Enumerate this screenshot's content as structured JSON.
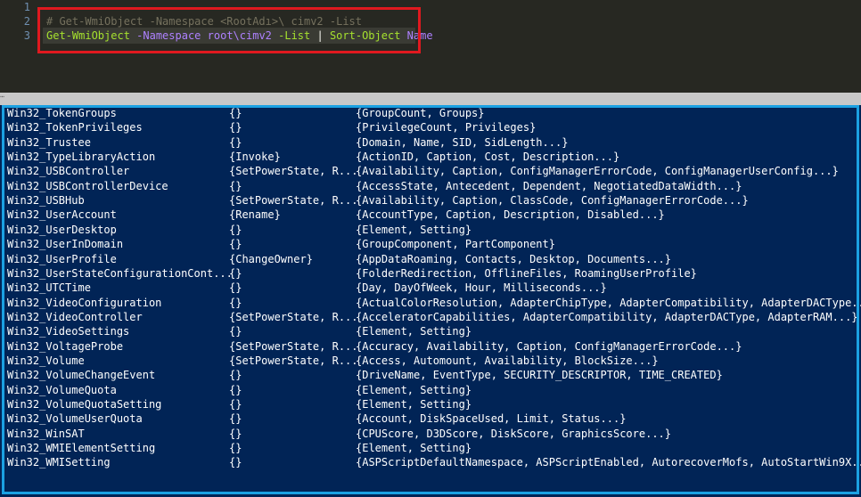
{
  "editor": {
    "line_numbers": [
      "1",
      "2",
      "3"
    ],
    "line2": "# Get-WmiObject -Namespace <RootAdı>\\ cimv2 -List",
    "line3": {
      "cmd1": "Get-WmiObject",
      "param1": "-Namespace",
      "arg1": "root\\cimv2",
      "param2": "-List",
      "pipe": "|",
      "cmd2": "Sort-Object",
      "arg2": "Name"
    }
  },
  "console": {
    "rows": [
      {
        "name": "Win32_TokenGroups",
        "methods": "{}",
        "properties": "{GroupCount, Groups}"
      },
      {
        "name": "Win32_TokenPrivileges",
        "methods": "{}",
        "properties": "{PrivilegeCount, Privileges}"
      },
      {
        "name": "Win32_Trustee",
        "methods": "{}",
        "properties": "{Domain, Name, SID, SidLength...}"
      },
      {
        "name": "Win32_TypeLibraryAction",
        "methods": "{Invoke}",
        "properties": "{ActionID, Caption, Cost, Description...}"
      },
      {
        "name": "Win32_USBController",
        "methods": "{SetPowerState, R...",
        "properties": "{Availability, Caption, ConfigManagerErrorCode, ConfigManagerUserConfig...}"
      },
      {
        "name": "Win32_USBControllerDevice",
        "methods": "{}",
        "properties": "{AccessState, Antecedent, Dependent, NegotiatedDataWidth...}"
      },
      {
        "name": "Win32_USBHub",
        "methods": "{SetPowerState, R...",
        "properties": "{Availability, Caption, ClassCode, ConfigManagerErrorCode...}"
      },
      {
        "name": "Win32_UserAccount",
        "methods": "{Rename}",
        "properties": "{AccountType, Caption, Description, Disabled...}"
      },
      {
        "name": "Win32_UserDesktop",
        "methods": "{}",
        "properties": "{Element, Setting}"
      },
      {
        "name": "Win32_UserInDomain",
        "methods": "{}",
        "properties": "{GroupComponent, PartComponent}"
      },
      {
        "name": "Win32_UserProfile",
        "methods": "{ChangeOwner}",
        "properties": "{AppDataRoaming, Contacts, Desktop, Documents...}"
      },
      {
        "name": "Win32_UserStateConfigurationCont...",
        "methods": "{}",
        "properties": "{FolderRedirection, OfflineFiles, RoamingUserProfile}"
      },
      {
        "name": "Win32_UTCTime",
        "methods": "{}",
        "properties": "{Day, DayOfWeek, Hour, Milliseconds...}"
      },
      {
        "name": "Win32_VideoConfiguration",
        "methods": "{}",
        "properties": "{ActualColorResolution, AdapterChipType, AdapterCompatibility, AdapterDACType..."
      },
      {
        "name": "Win32_VideoController",
        "methods": "{SetPowerState, R...",
        "properties": "{AcceleratorCapabilities, AdapterCompatibility, AdapterDACType, AdapterRAM...}"
      },
      {
        "name": "Win32_VideoSettings",
        "methods": "{}",
        "properties": "{Element, Setting}"
      },
      {
        "name": "Win32_VoltageProbe",
        "methods": "{SetPowerState, R...",
        "properties": "{Accuracy, Availability, Caption, ConfigManagerErrorCode...}"
      },
      {
        "name": "Win32_Volume",
        "methods": "{SetPowerState, R...",
        "properties": "{Access, Automount, Availability, BlockSize...}"
      },
      {
        "name": "Win32_VolumeChangeEvent",
        "methods": "{}",
        "properties": "{DriveName, EventType, SECURITY_DESCRIPTOR, TIME_CREATED}"
      },
      {
        "name": "Win32_VolumeQuota",
        "methods": "{}",
        "properties": "{Element, Setting}"
      },
      {
        "name": "Win32_VolumeQuotaSetting",
        "methods": "{}",
        "properties": "{Element, Setting}"
      },
      {
        "name": "Win32_VolumeUserQuota",
        "methods": "{}",
        "properties": "{Account, DiskSpaceUsed, Limit, Status...}"
      },
      {
        "name": "Win32_WinSAT",
        "methods": "{}",
        "properties": "{CPUScore, D3DScore, DiskScore, GraphicsScore...}"
      },
      {
        "name": "Win32_WMIElementSetting",
        "methods": "{}",
        "properties": "{Element, Setting}"
      },
      {
        "name": "Win32_WMISetting",
        "methods": "{}",
        "properties": "{ASPScriptDefaultNamespace, ASPScriptEnabled, AutorecoverMofs, AutoStartWin9X..."
      }
    ]
  },
  "colors": {
    "editor_bg": "#272822",
    "console_bg": "#012456",
    "highlight_red": "#e0191f",
    "highlight_blue": "#1ba1e2"
  }
}
